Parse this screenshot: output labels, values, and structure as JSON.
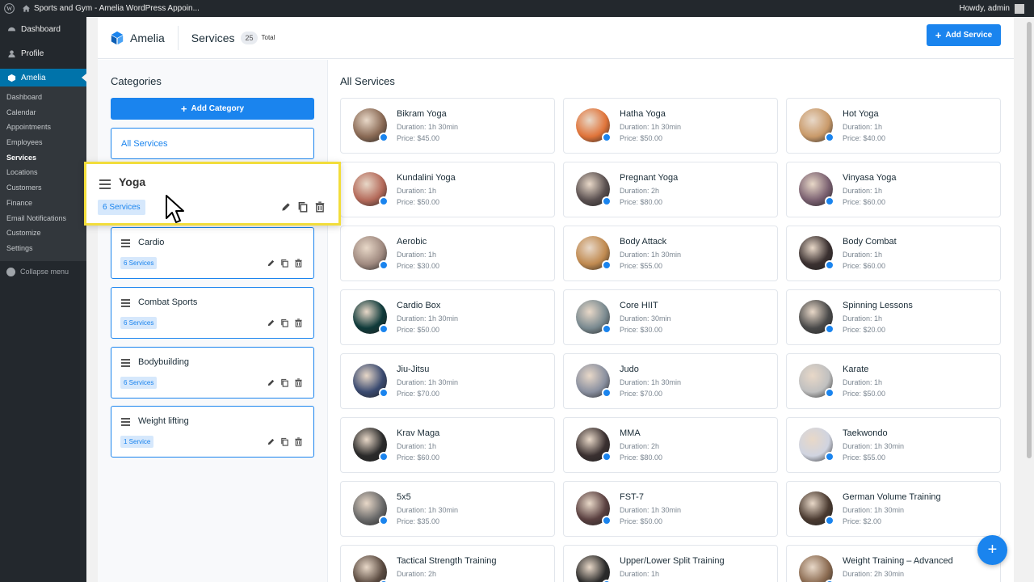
{
  "adminbar": {
    "site_title": "Sports and Gym - Amelia WordPress Appoin...",
    "greeting": "Howdy, admin"
  },
  "sidebar": {
    "top": [
      {
        "label": "Dashboard",
        "icon": "dashboard-icon"
      },
      {
        "label": "Profile",
        "icon": "profile-icon"
      }
    ],
    "active": {
      "label": "Amelia",
      "icon": "amelia-icon"
    },
    "submenu": [
      "Dashboard",
      "Calendar",
      "Appointments",
      "Employees",
      "Services",
      "Locations",
      "Customers",
      "Finance",
      "Email Notifications",
      "Customize",
      "Settings"
    ],
    "current_submenu": "Services",
    "collapse_label": "Collapse menu"
  },
  "header": {
    "brand": "Amelia",
    "title": "Services",
    "count": "25",
    "total_label": "Total",
    "add_service_label": "Add Service"
  },
  "categories": {
    "title": "Categories",
    "add_label": "Add Category",
    "all_services_label": "All Services",
    "dragging": {
      "name": "Yoga",
      "badge": "6 Services"
    },
    "items": [
      {
        "name": "Cardio",
        "badge": "6 Services"
      },
      {
        "name": "Combat Sports",
        "badge": "6 Services"
      },
      {
        "name": "Bodybuilding",
        "badge": "6 Services"
      },
      {
        "name": "Weight lifting",
        "badge": "1 Service"
      }
    ]
  },
  "services": {
    "title": "All Services",
    "items": [
      {
        "name": "Bikram Yoga",
        "duration": "Duration: 1h 30min",
        "price": "Price: $45.00",
        "color": "#8a6a55"
      },
      {
        "name": "Hatha Yoga",
        "duration": "Duration: 1h 30min",
        "price": "Price: $50.00",
        "color": "#e0743a"
      },
      {
        "name": "Hot Yoga",
        "duration": "Duration: 1h",
        "price": "Price: $40.00",
        "color": "#c99a6a"
      },
      {
        "name": "Kundalini Yoga",
        "duration": "Duration: 1h",
        "price": "Price: $50.00",
        "color": "#b46a5a"
      },
      {
        "name": "Pregnant Yoga",
        "duration": "Duration: 2h",
        "price": "Price: $80.00",
        "color": "#5a5050"
      },
      {
        "name": "Vinyasa Yoga",
        "duration": "Duration: 1h",
        "price": "Price: $60.00",
        "color": "#7a6070"
      },
      {
        "name": "Aerobic",
        "duration": "Duration: 1h",
        "price": "Price: $30.00",
        "color": "#a08a80"
      },
      {
        "name": "Body Attack",
        "duration": "Duration: 1h 30min",
        "price": "Price: $55.00",
        "color": "#c08a50"
      },
      {
        "name": "Body Combat",
        "duration": "Duration: 1h",
        "price": "Price: $60.00",
        "color": "#3a3030"
      },
      {
        "name": "Cardio Box",
        "duration": "Duration: 1h 30min",
        "price": "Price: $50.00",
        "color": "#0f3a3a"
      },
      {
        "name": "Core HIIT",
        "duration": "Duration: 30min",
        "price": "Price: $30.00",
        "color": "#7a8a90"
      },
      {
        "name": "Spinning Lessons",
        "duration": "Duration: 1h",
        "price": "Price: $20.00",
        "color": "#4a4a4a"
      },
      {
        "name": "Jiu-Jitsu",
        "duration": "Duration: 1h 30min",
        "price": "Price: $70.00",
        "color": "#3a4a70"
      },
      {
        "name": "Judo",
        "duration": "Duration: 1h 30min",
        "price": "Price: $70.00",
        "color": "#8a90a0"
      },
      {
        "name": "Karate",
        "duration": "Duration: 1h",
        "price": "Price: $50.00",
        "color": "#c0c0c0"
      },
      {
        "name": "Krav Maga",
        "duration": "Duration: 1h",
        "price": "Price: $60.00",
        "color": "#2a2a2a"
      },
      {
        "name": "MMA",
        "duration": "Duration: 2h",
        "price": "Price: $80.00",
        "color": "#3a3030"
      },
      {
        "name": "Taekwondo",
        "duration": "Duration: 1h 30min",
        "price": "Price: $55.00",
        "color": "#d0d4e0"
      },
      {
        "name": "5x5",
        "duration": "Duration: 1h 30min",
        "price": "Price: $35.00",
        "color": "#6a6a6a"
      },
      {
        "name": "FST-7",
        "duration": "Duration: 1h 30min",
        "price": "Price: $50.00",
        "color": "#5a4040"
      },
      {
        "name": "German Volume Training",
        "duration": "Duration: 1h 30min",
        "price": "Price: $2.00",
        "color": "#4a3a30"
      },
      {
        "name": "Tactical Strength Training",
        "duration": "Duration: 2h",
        "price": "",
        "color": "#5a4a40"
      },
      {
        "name": "Upper/Lower Split Training",
        "duration": "Duration: 1h",
        "price": "",
        "color": "#2a2a2a"
      },
      {
        "name": "Weight Training – Advanced",
        "duration": "Duration: 2h 30min",
        "price": "",
        "color": "#8a6a50"
      }
    ]
  },
  "colors": {
    "accent": "#1a84ee",
    "highlight": "#f2dd3b",
    "wp_dark": "#23282d",
    "wp_active": "#0073aa"
  }
}
